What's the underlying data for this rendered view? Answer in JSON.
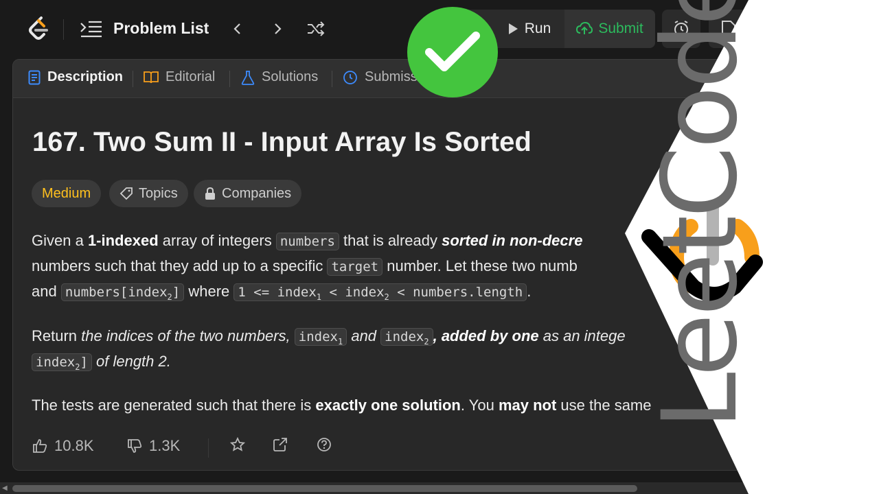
{
  "topbar": {
    "problem_list_label": "Problem List",
    "run_label": "Run",
    "submit_label": "Submit"
  },
  "tabs": [
    {
      "label": "Description"
    },
    {
      "label": "Editorial"
    },
    {
      "label": "Solutions"
    },
    {
      "label": "Submissi"
    }
  ],
  "problem": {
    "title": "167. Two Sum II - Input Array Is Sorted",
    "difficulty": "Medium",
    "topics_label": "Topics",
    "companies_label": "Companies",
    "p1": {
      "t1": "Given a ",
      "b1": "1-indexed",
      "t2": " array of integers ",
      "c1": "numbers",
      "t3": " that is already ",
      "bi1": "sorted in non-decre",
      "t4": "numbers such that they add up to a specific ",
      "c2": "target",
      "t5": " number. Let these two numb",
      "t6": "and ",
      "c3": "numbers[index",
      "c3sub": "2",
      "c3end": "]",
      "t7": " where ",
      "c4a": "1 <= index",
      "c4sub1": "1",
      "c4b": " < index",
      "c4sub2": "2",
      "c4c": " < numbers.length",
      "t8": "."
    },
    "p2": {
      "t1": "Return ",
      "i1": "the indices of the two numbers, ",
      "c1": "index",
      "c1sub": "1",
      "i2": " and ",
      "c2": "index",
      "c2sub": "2",
      "bi1": ", added by one",
      "i3": " as an intege",
      "c3": "index",
      "c3sub": "2",
      "c3end": "]",
      "i4": " of length 2."
    },
    "p3": {
      "t1": "The tests are generated such that there is ",
      "b1": "exactly one solution",
      "t2": ". You ",
      "b2": "may not",
      "t3": " use the same"
    }
  },
  "actions": {
    "likes": "10.8K",
    "dislikes": "1.3K"
  },
  "brand": {
    "wordmark": "LeetCode",
    "orange": "#f89f1b",
    "gray": "#b3b3b3",
    "black": "#000000"
  },
  "colors": {
    "medium": "#ffc01e",
    "submit": "#2cbb5d",
    "check": "#44c53e"
  }
}
